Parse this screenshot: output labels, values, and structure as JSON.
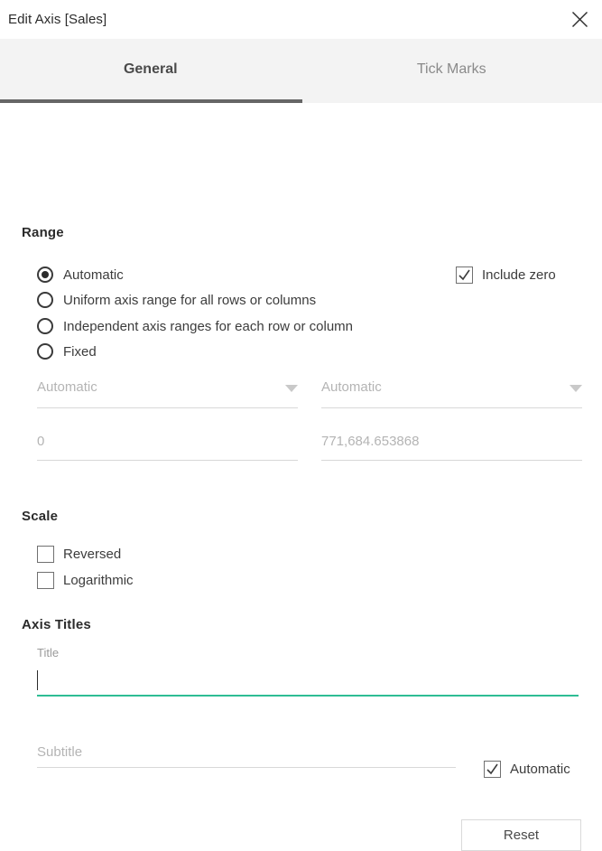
{
  "window": {
    "title": "Edit Axis [Sales]",
    "close_icon": "close-icon"
  },
  "tabs": [
    {
      "label": "General",
      "active": true
    },
    {
      "label": "Tick Marks",
      "active": false
    }
  ],
  "range": {
    "heading": "Range",
    "options": [
      {
        "label": "Automatic",
        "selected": true
      },
      {
        "label": "Uniform axis range for all rows or columns",
        "selected": false
      },
      {
        "label": "Independent axis ranges for each row or column",
        "selected": false
      },
      {
        "label": "Fixed",
        "selected": false
      }
    ],
    "include_zero": {
      "label": "Include zero",
      "checked": true
    },
    "start_dropdown": {
      "value": "Automatic",
      "icon": "chevron-down-icon"
    },
    "end_dropdown": {
      "value": "Automatic",
      "icon": "chevron-down-icon"
    },
    "start_value": "0",
    "end_value": "771,684.653868"
  },
  "scale": {
    "heading": "Scale",
    "options": [
      {
        "label": "Reversed",
        "checked": false
      },
      {
        "label": "Logarithmic",
        "checked": false
      }
    ]
  },
  "axis_titles": {
    "heading": "Axis Titles",
    "title_label": "Title",
    "title_value": "",
    "subtitle_placeholder": "Subtitle",
    "subtitle_value": "",
    "automatic": {
      "label": "Automatic",
      "checked": true
    }
  },
  "footer": {
    "reset_label": "Reset"
  },
  "colors": {
    "accent": "#2ebd94",
    "tab_underline": "#666666",
    "tab_strip_bg": "#f3f3f3"
  }
}
